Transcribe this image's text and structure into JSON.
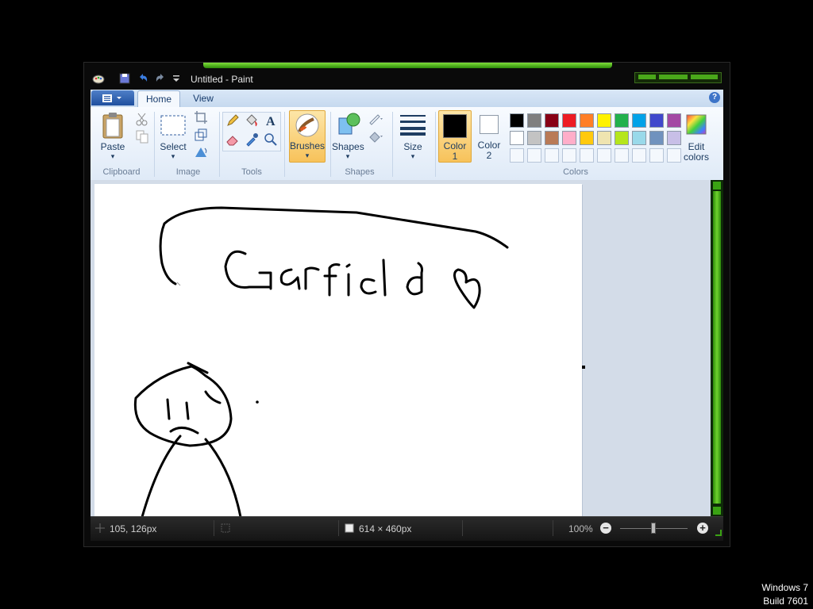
{
  "window": {
    "title": "Untitled - Paint"
  },
  "tabs": {
    "home": "Home",
    "view": "View"
  },
  "clipboard": {
    "paste": "Paste",
    "group": "Clipboard"
  },
  "image": {
    "select": "Select",
    "group": "Image"
  },
  "tools": {
    "group": "Tools",
    "text_glyph": "A"
  },
  "brushes": {
    "label": "Brushes"
  },
  "shapes": {
    "label": "Shapes",
    "group": "Shapes"
  },
  "size": {
    "label": "Size"
  },
  "color1": {
    "line1": "Color",
    "line2": "1",
    "value": "#000000"
  },
  "color2": {
    "line1": "Color",
    "line2": "2",
    "value": "#ffffff"
  },
  "colors": {
    "group": "Colors",
    "edit_line1": "Edit",
    "edit_line2": "colors",
    "palette_row1": [
      "#000000",
      "#7f7f7f",
      "#880015",
      "#ed1c24",
      "#ff7f27",
      "#fff200",
      "#22b14c",
      "#00a2e8",
      "#3f48cc",
      "#a349a4"
    ],
    "palette_row2": [
      "#ffffff",
      "#c3c3c3",
      "#b97a57",
      "#ffaec9",
      "#ffc90e",
      "#efe4b0",
      "#b5e61d",
      "#99d9ea",
      "#7092be",
      "#c8bfe7"
    ]
  },
  "canvas": {
    "text": "Garfield"
  },
  "status": {
    "cursor_pos": "105, 126px",
    "canvas_size": "614 × 460px",
    "zoom": "100%"
  },
  "os": {
    "line1": "Windows 7",
    "line2": "Build 7601"
  }
}
